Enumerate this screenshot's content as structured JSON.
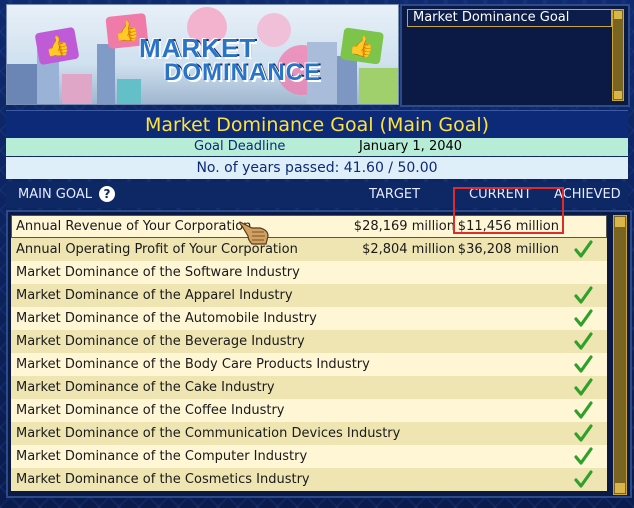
{
  "banner": {
    "logo_line1": "MARKET",
    "logo_line2": "DOMINANCE"
  },
  "side_panel": {
    "title": "Market Dominance Goal"
  },
  "header": {
    "title": "Market Dominance Goal (Main Goal)",
    "deadline_label": "Goal Deadline",
    "deadline_value": "January 1, 2040",
    "years_passed": "No. of years passed: 41.60 / 50.00"
  },
  "columns": {
    "main_goal": "MAIN GOAL",
    "help": "?",
    "target": "TARGET",
    "current": "CURRENT",
    "achieved": "ACHIEVED"
  },
  "colors": {
    "title_yellow": "#ffe23a",
    "check_green": "#2fa12a",
    "highlight_red": "#e12a2a"
  },
  "goals": [
    {
      "goal": "Annual Revenue of Your Corporation",
      "target": "$28,169 million",
      "current": "$11,456 million",
      "achieved": false
    },
    {
      "goal": "Annual Operating Profit of Your Corporation",
      "target": "$2,804 million",
      "current": "$36,208 million",
      "achieved": true
    },
    {
      "goal": "Market Dominance of the Software Industry",
      "target": "",
      "current": "",
      "achieved": false
    },
    {
      "goal": "Market Dominance of the Apparel Industry",
      "target": "",
      "current": "",
      "achieved": true
    },
    {
      "goal": "Market Dominance of the Automobile Industry",
      "target": "",
      "current": "",
      "achieved": true
    },
    {
      "goal": "Market Dominance of the Beverage Industry",
      "target": "",
      "current": "",
      "achieved": true
    },
    {
      "goal": "Market Dominance of the Body Care Products Industry",
      "target": "",
      "current": "",
      "achieved": true
    },
    {
      "goal": "Market Dominance of the Cake Industry",
      "target": "",
      "current": "",
      "achieved": true
    },
    {
      "goal": "Market Dominance of the Coffee Industry",
      "target": "",
      "current": "",
      "achieved": true
    },
    {
      "goal": "Market Dominance of the Communication Devices Industry",
      "target": "",
      "current": "",
      "achieved": true
    },
    {
      "goal": "Market Dominance of the Computer Industry",
      "target": "",
      "current": "",
      "achieved": true
    },
    {
      "goal": "Market Dominance of the Cosmetics Industry",
      "target": "",
      "current": "",
      "achieved": true
    }
  ]
}
